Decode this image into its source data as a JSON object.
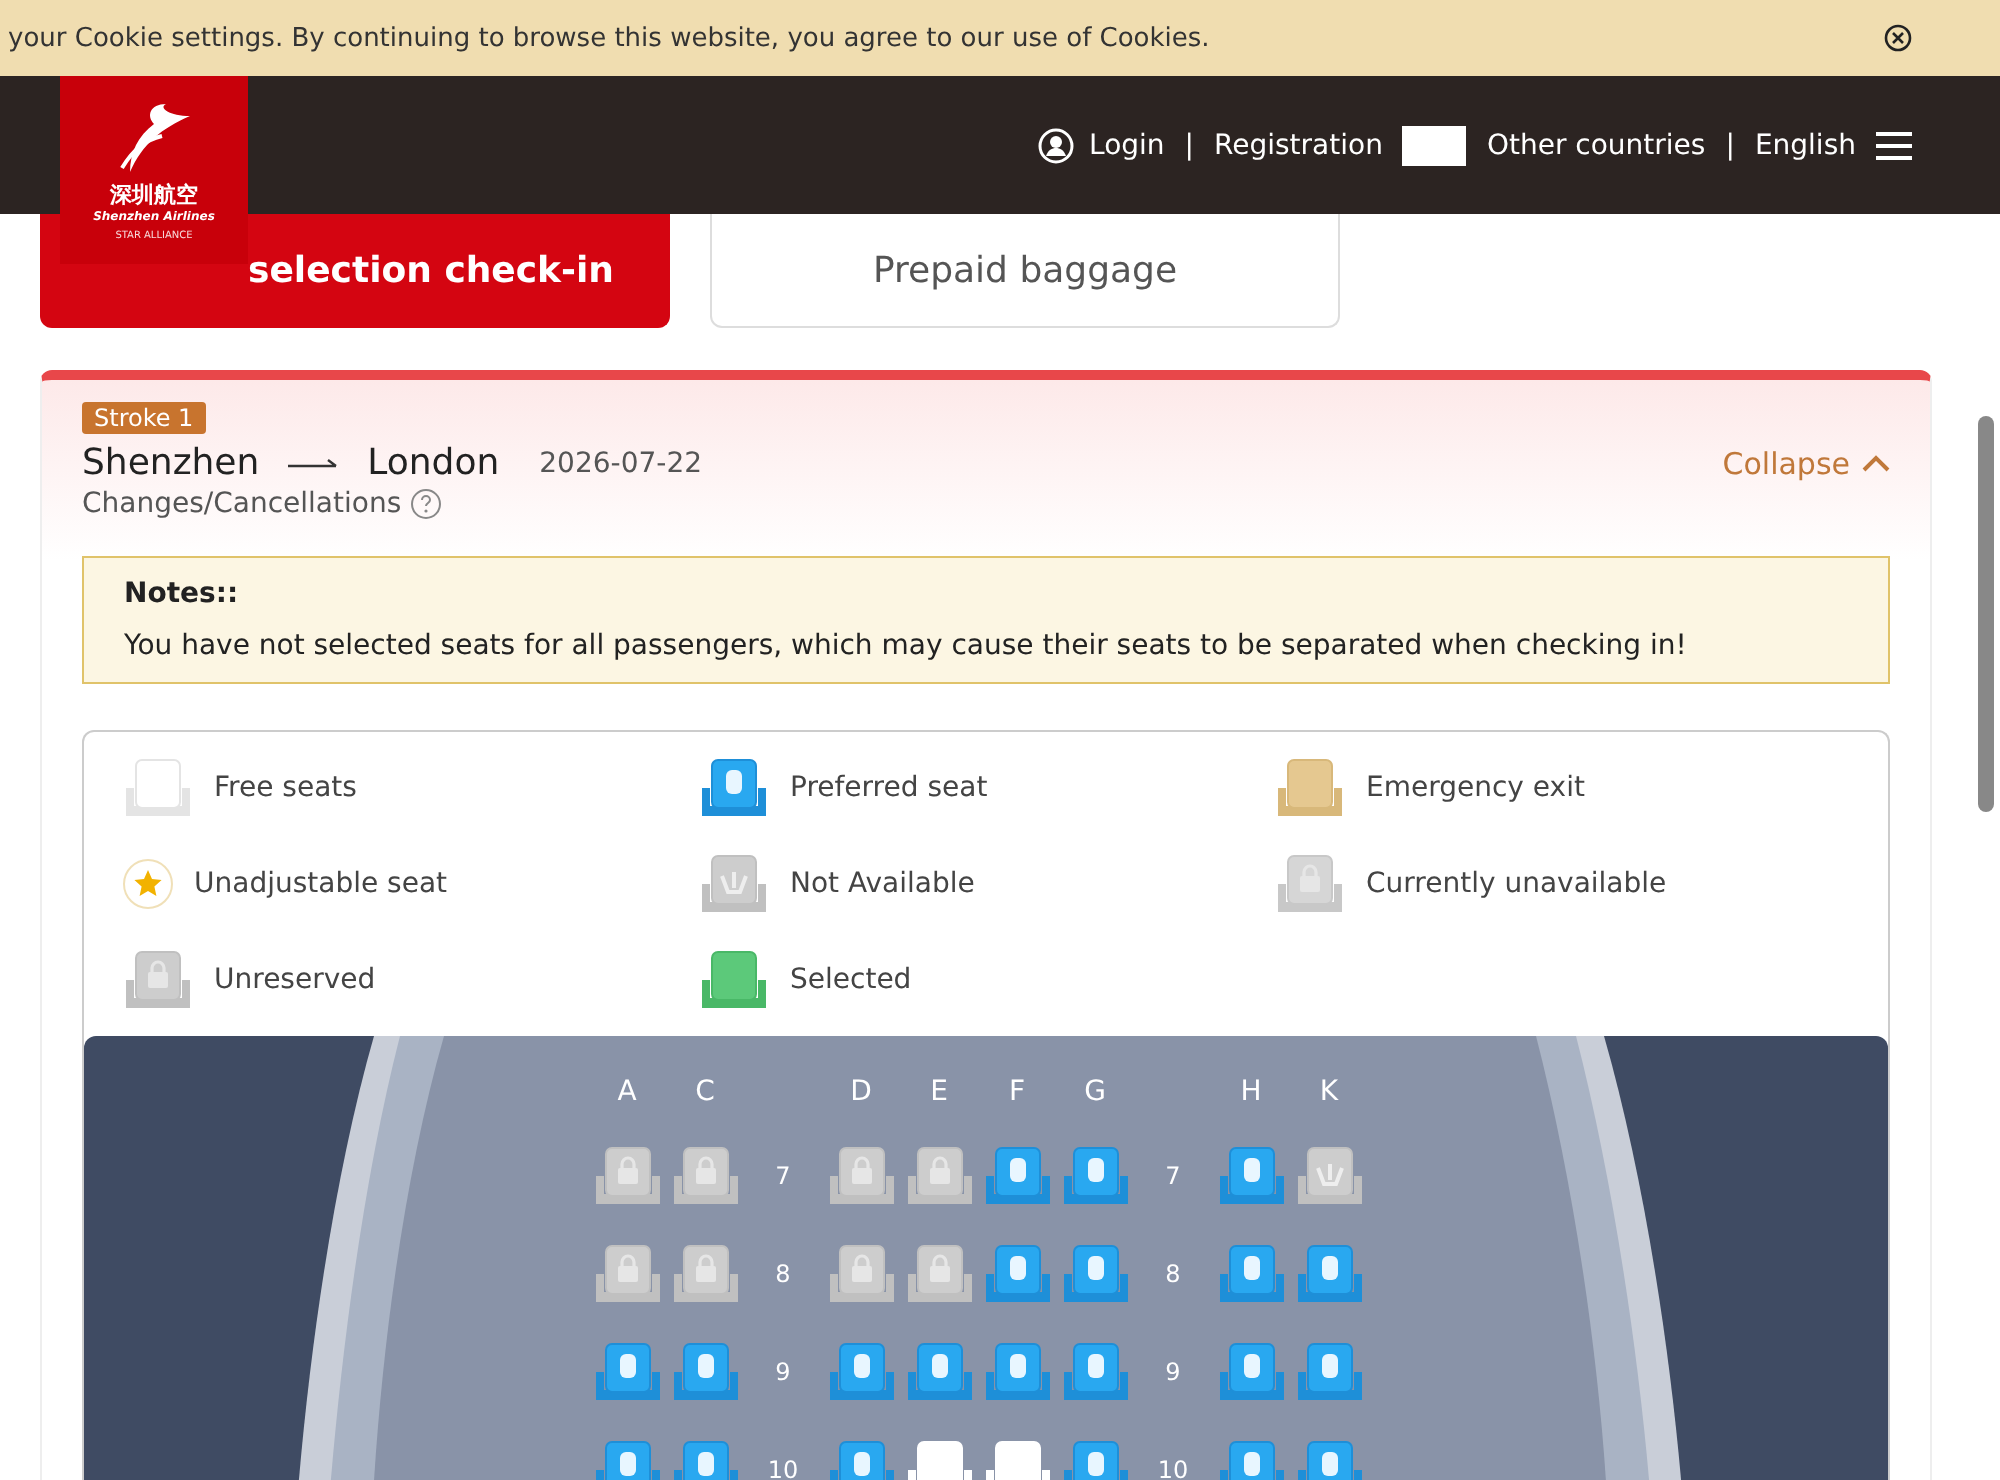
{
  "cookie_banner": {
    "text": "your Cookie settings. By continuing to browse this website, you agree to our use of Cookies."
  },
  "logo": {
    "name_cn": "深圳航空",
    "name_en": "Shenzhen Airlines",
    "alliance": "STAR ALLIANCE"
  },
  "header": {
    "login": "Login",
    "separator_1": "|",
    "registration": "Registration",
    "region": "Other countries",
    "separator_2": "|",
    "language": "English"
  },
  "tabs": [
    {
      "label": "selection check-in",
      "selected": true
    },
    {
      "label": "Prepaid baggage",
      "selected": false
    }
  ],
  "segment": {
    "badge": "Stroke 1",
    "from": "Shenzhen",
    "to": "London",
    "date": "2026-07-22",
    "changes": "Changes/Cancellations",
    "toggle": "Collapse",
    "expanded": true
  },
  "notes": {
    "title": "Notes::",
    "text": "You have not selected seats for all passengers, which may cause their seats to be separated when checking in!"
  },
  "legend": [
    {
      "kind": "free",
      "label": "Free seats"
    },
    {
      "kind": "preferred",
      "label": "Preferred seat"
    },
    {
      "kind": "emergency",
      "label": "Emergency exit"
    },
    {
      "kind": "unadjustable",
      "label": "Unadjustable seat"
    },
    {
      "kind": "not_available",
      "label": "Not Available"
    },
    {
      "kind": "unavailable",
      "label": "Currently unavailable"
    },
    {
      "kind": "unreserved",
      "label": "Unreserved"
    },
    {
      "kind": "selected",
      "label": "Selected"
    }
  ],
  "seat_map": {
    "column_groups": [
      [
        "A",
        "C"
      ],
      [
        "D",
        "E",
        "F",
        "G"
      ],
      [
        "H",
        "K"
      ]
    ],
    "rows": [
      {
        "labels": [
          "7",
          "7"
        ],
        "groups": [
          [
            {
              "kind": "unreserved"
            },
            {
              "kind": "unreserved"
            }
          ],
          [
            {
              "kind": "unreserved"
            },
            {
              "kind": "unreserved"
            },
            {
              "kind": "preferred"
            },
            {
              "kind": "preferred"
            }
          ],
          [
            {
              "kind": "preferred"
            },
            {
              "kind": "not_available"
            }
          ]
        ]
      },
      {
        "labels": [
          "8",
          "8"
        ],
        "groups": [
          [
            {
              "kind": "unreserved"
            },
            {
              "kind": "unreserved"
            }
          ],
          [
            {
              "kind": "unreserved"
            },
            {
              "kind": "unreserved"
            },
            {
              "kind": "preferred"
            },
            {
              "kind": "preferred"
            }
          ],
          [
            {
              "kind": "preferred"
            },
            {
              "kind": "preferred"
            }
          ]
        ]
      },
      {
        "labels": [
          "9",
          "9"
        ],
        "groups": [
          [
            {
              "kind": "preferred"
            },
            {
              "kind": "preferred"
            }
          ],
          [
            {
              "kind": "preferred"
            },
            {
              "kind": "preferred"
            },
            {
              "kind": "preferred"
            },
            {
              "kind": "preferred"
            }
          ],
          [
            {
              "kind": "preferred"
            },
            {
              "kind": "preferred"
            }
          ]
        ]
      },
      {
        "labels": [
          "10",
          "10"
        ],
        "groups": [
          [
            {
              "kind": "preferred"
            },
            {
              "kind": "preferred"
            }
          ],
          [
            {
              "kind": "preferred"
            },
            {
              "kind": "free"
            },
            {
              "kind": "free"
            },
            {
              "kind": "preferred"
            }
          ],
          [
            {
              "kind": "preferred"
            },
            {
              "kind": "preferred"
            }
          ]
        ]
      }
    ]
  }
}
